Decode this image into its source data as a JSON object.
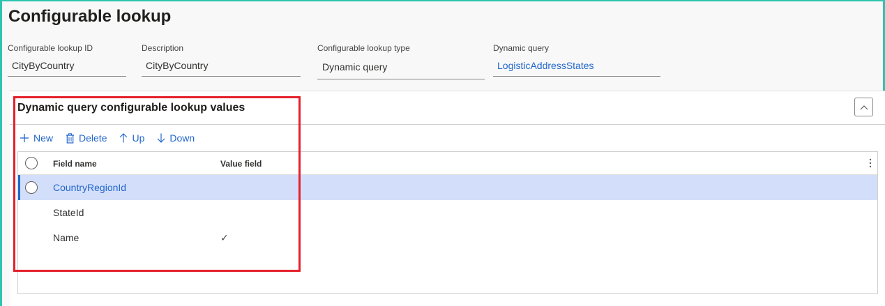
{
  "page": {
    "title": "Configurable lookup"
  },
  "fields": [
    {
      "label": "Configurable lookup ID",
      "value": "CityByCountry"
    },
    {
      "label": "Description",
      "value": "CityByCountry"
    },
    {
      "label": "Configurable lookup type",
      "value": "Dynamic query"
    },
    {
      "label": "Dynamic query",
      "value": "LogisticAddressStates"
    }
  ],
  "section": {
    "title": "Dynamic query configurable lookup values",
    "toolbar": {
      "new_label": "New",
      "delete_label": "Delete",
      "up_label": "Up",
      "down_label": "Down"
    },
    "grid": {
      "columns": [
        "Field name",
        "Value field"
      ],
      "rows": [
        {
          "field_name": "CountryRegionId",
          "value_field": "",
          "selected": true
        },
        {
          "field_name": "StateId",
          "value_field": ""
        },
        {
          "field_name": "Name",
          "value_field": "✓"
        }
      ]
    }
  },
  "colors": {
    "accent": "#2266cc",
    "selected_row": "#d3dffa",
    "frame": "#2ec4b0",
    "highlight": "#e5202b"
  },
  "icons": [
    "plus-icon",
    "trash-icon",
    "arrow-up-icon",
    "arrow-down-icon",
    "chevron-up-icon",
    "more-vertical-icon",
    "checkmark-icon"
  ]
}
